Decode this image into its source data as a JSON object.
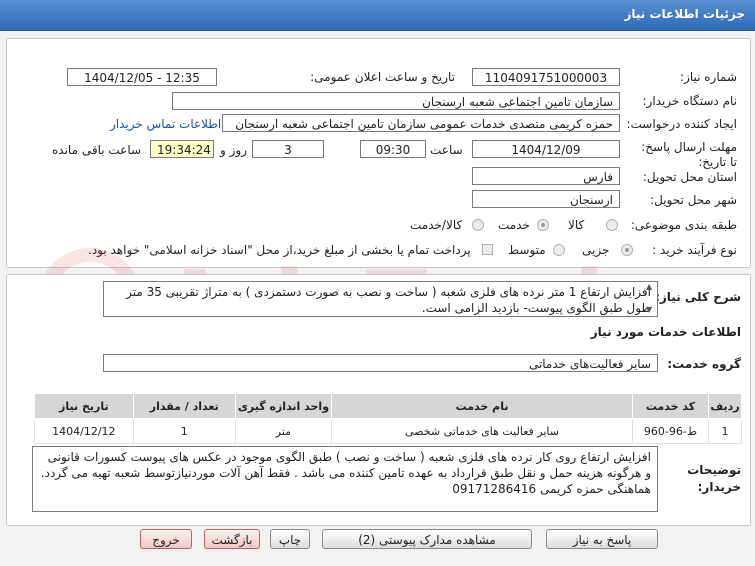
{
  "window": {
    "title": "جزئیات اطلاعات نیاز"
  },
  "form": {
    "need_number_label": "شماره نیاز:",
    "need_number": "1104091751000003",
    "announce_label": "تاریخ و ساعت اعلان عمومی:",
    "announce_value": "1404/12/05 - 12:35",
    "buyer_org_label": "نام دستگاه خریدار:",
    "buyer_org": "سازمان تامین اجتماعی شعبه ارسنجان",
    "requester_label": "ایجاد کننده درخواست:",
    "requester": "حمزه  کریمی متصدی خدمات عمومی  سازمان تامین اجتماعی شعبه ارسنجان",
    "contact_link": "اطلاعات تماس خریدار",
    "deadline_label": "مهلت ارسال پاسخ: تا تاریخ:",
    "deadline_date": "1404/12/09",
    "time_label": "ساعت",
    "deadline_time": "09:30",
    "days_value": "3",
    "days_label": "روز و",
    "remaining_time": "19:34:24",
    "remaining_label": "ساعت باقی مانده",
    "province_label": "استان محل تحویل:",
    "province": "فارس",
    "city_label": "شهر محل تحویل:",
    "city": "ارسنجان",
    "category_label": "طبقه بندی موضوعی:",
    "category_options": [
      "کالا",
      "خدمت",
      "کالا/خدمت"
    ],
    "category_selected": "خدمت",
    "process_label": "نوع فرآیند خرید :",
    "process_options": [
      "جزیی",
      "متوسط"
    ],
    "process_selected": "جزیی",
    "payment_note": "پرداخت تمام یا بخشی از مبلغ خرید،از محل \"اسناد خزانه اسلامی\" خواهد بود."
  },
  "description": {
    "label": "شرح کلی نیاز:",
    "text": "افزایش ارتفاع  1 متر نرده های فلزی شعبه ( ساخت و نصب به صورت دستمزدی ) به متراژ تقریبی 35 متر طول طبق الگوی پیوست-  بازدید الزامی است."
  },
  "services": {
    "section_title": "اطلاعات خدمات مورد نیاز",
    "group_label": "گروه خدمت:",
    "group_value": "سایر فعالیت‌های خدماتی",
    "columns": [
      "ردیف",
      "کد خدمت",
      "نام خدمت",
      "واحد اندازه گیری",
      "تعداد / مقدار",
      "تاریخ نیاز"
    ],
    "rows": [
      [
        "1",
        "ط-96-960",
        "سایر فعالیت های خدماتی شخصی",
        "متر",
        "1",
        "1404/12/12"
      ]
    ]
  },
  "buyer_notes": {
    "label": "توضیحات خریدار:",
    "text": "افزایش ارتفاع روی کار نرده های فلزی شعبه ( ساخت و نصب ) طبق الگوی موجود در عکس های پیوست کسورات قانونی و هرگونه هزینه حمل و نقل طبق قرارداد به عهده تامین کننده می باشد . فقط آهن آلات  موردنیازتوسط شعبه تهیه می گردد. هماهنگی حمزه کریمی  09171286416"
  },
  "buttons": {
    "reply": "پاسخ به نیاز",
    "attachments": "مشاهده مدارک پیوستی (2)",
    "print": "چاپ",
    "back": "بازگشت",
    "exit": "خروج"
  },
  "watermark": {
    "text": "AriaTender.net"
  },
  "colors": {
    "title_bar": "#2f6ab8",
    "link": "#1a4fb3",
    "highlight": "#ffffc8",
    "watermark": "#c0392b"
  }
}
